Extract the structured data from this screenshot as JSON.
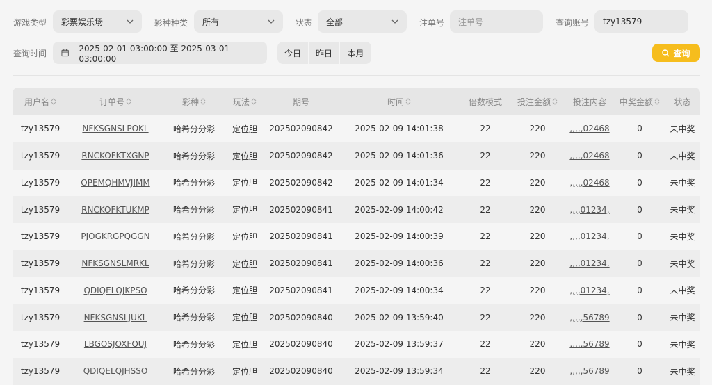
{
  "filters": {
    "game_type_label": "游戏类型",
    "game_type_value": "彩票娱乐场",
    "lottery_label": "彩种种类",
    "lottery_value": "所有",
    "status_label": "状态",
    "status_value": "全部",
    "order_label": "注单号",
    "order_placeholder": "注单号",
    "account_label": "查询账号",
    "account_value": "tzy13579",
    "time_label": "查询时间",
    "time_range": "2025-02-01 03:00:00 至 2025-03-01 03:00:00",
    "today": "今日",
    "yesterday": "昨日",
    "this_month": "本月",
    "search": "查询"
  },
  "colors": {
    "accent": "#f6bd1d"
  },
  "table": {
    "headers": [
      "用户名",
      "订单号",
      "彩种",
      "玩法",
      "期号",
      "时间",
      "倍数模式",
      "投注金额",
      "投注内容",
      "中奖金额",
      "状态"
    ],
    "rows": [
      [
        "tzy13579",
        "NFKSGNSLPOKL",
        "哈希分分彩",
        "定位胆",
        "202502090842",
        "2025-02-09 14:01:38",
        "22",
        "220",
        ",,,,,02468",
        "0",
        "未中奖"
      ],
      [
        "tzy13579",
        "RNCKOFKTXGNP",
        "哈希分分彩",
        "定位胆",
        "202502090842",
        "2025-02-09 14:01:36",
        "22",
        "220",
        ",,,,,02468",
        "0",
        "未中奖"
      ],
      [
        "tzy13579",
        "OPEMQHMVJIMM",
        "哈希分分彩",
        "定位胆",
        "202502090842",
        "2025-02-09 14:01:34",
        "22",
        "220",
        ",,,,,02468",
        "0",
        "未中奖"
      ],
      [
        "tzy13579",
        "RNCKOFKTUKMP",
        "哈希分分彩",
        "定位胆",
        "202502090841",
        "2025-02-09 14:00:42",
        "22",
        "220",
        ",,,,01234,",
        "0",
        "未中奖"
      ],
      [
        "tzy13579",
        "PJOGKRGPQGGN",
        "哈希分分彩",
        "定位胆",
        "202502090841",
        "2025-02-09 14:00:39",
        "22",
        "220",
        ",,,,01234,",
        "0",
        "未中奖"
      ],
      [
        "tzy13579",
        "NFKSGNSLMRKL",
        "哈希分分彩",
        "定位胆",
        "202502090841",
        "2025-02-09 14:00:36",
        "22",
        "220",
        ",,,,01234,",
        "0",
        "未中奖"
      ],
      [
        "tzy13579",
        "QDIQELQJKPSO",
        "哈希分分彩",
        "定位胆",
        "202502090841",
        "2025-02-09 14:00:34",
        "22",
        "220",
        ",,,,01234,",
        "0",
        "未中奖"
      ],
      [
        "tzy13579",
        "NFKSGNSLJUKL",
        "哈希分分彩",
        "定位胆",
        "202502090840",
        "2025-02-09 13:59:40",
        "22",
        "220",
        ",,,,,56789",
        "0",
        "未中奖"
      ],
      [
        "tzy13579",
        "LBGOSJOXFQUJ",
        "哈希分分彩",
        "定位胆",
        "202502090840",
        "2025-02-09 13:59:37",
        "22",
        "220",
        ",,,,,56789",
        "0",
        "未中奖"
      ],
      [
        "tzy13579",
        "QDIQELQJHSSO",
        "哈希分分彩",
        "定位胆",
        "202502090840",
        "2025-02-09 13:59:34",
        "22",
        "220",
        ",,,,,56789",
        "0",
        "未中奖"
      ]
    ]
  }
}
